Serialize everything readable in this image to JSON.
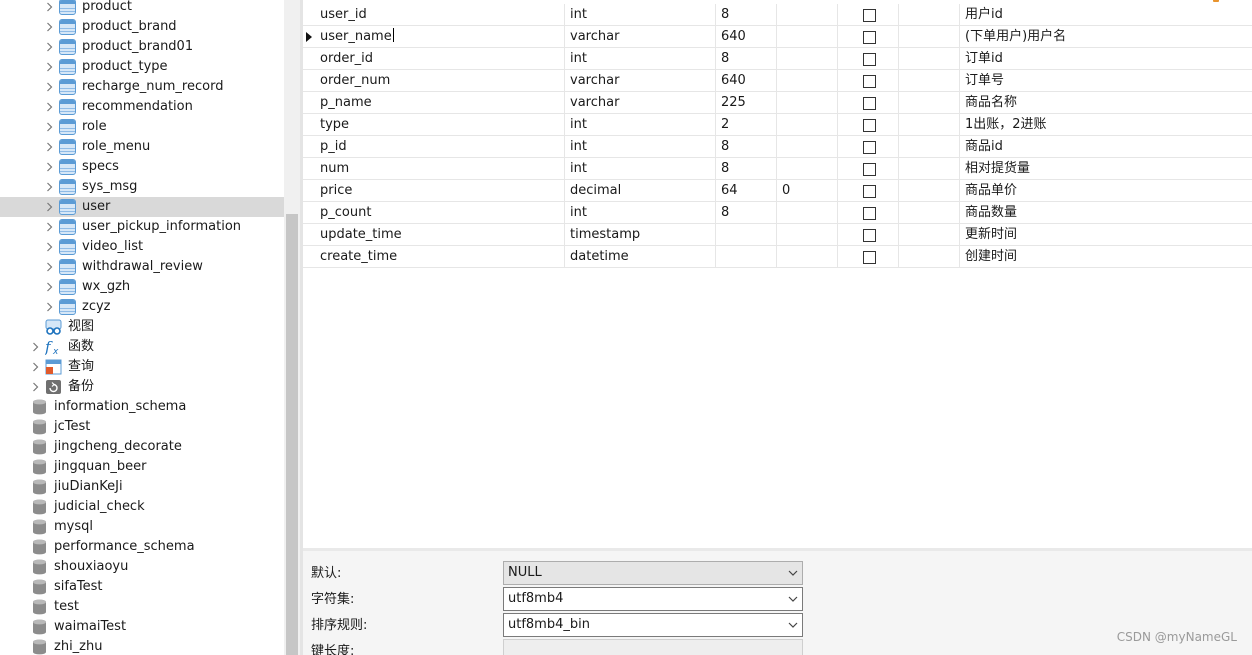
{
  "sidebar": {
    "tables": [
      "product",
      "product_brand",
      "product_brand01",
      "product_type",
      "recharge_num_record",
      "recommendation",
      "role",
      "role_menu",
      "specs",
      "sys_msg",
      "user",
      "user_pickup_information",
      "video_list",
      "withdrawal_review",
      "wx_gzh",
      "zcyz"
    ],
    "selected_table": "user",
    "views_label": "视图",
    "functions_label": "函数",
    "queries_label": "查询",
    "backups_label": "备份",
    "databases": [
      "information_schema",
      "jcTest",
      "jingcheng_decorate",
      "jingquan_beer",
      "jiuDianKeJi",
      "judicial_check",
      "mysql",
      "performance_schema",
      "shouxiaoyu",
      "sifaTest",
      "test",
      "waimaiTest",
      "zhi_zhu"
    ]
  },
  "fields": [
    {
      "name": "user_id",
      "type": "int",
      "length": "8",
      "decimals": "",
      "not_null": false,
      "key": "",
      "comment": "用户id"
    },
    {
      "name": "user_name",
      "type": "varchar",
      "length": "640",
      "decimals": "",
      "not_null": false,
      "key": "",
      "comment": "(下单用户)用户名"
    },
    {
      "name": "order_id",
      "type": "int",
      "length": "8",
      "decimals": "",
      "not_null": false,
      "key": "",
      "comment": "订单id"
    },
    {
      "name": "order_num",
      "type": "varchar",
      "length": "640",
      "decimals": "",
      "not_null": false,
      "key": "",
      "comment": "订单号"
    },
    {
      "name": "p_name",
      "type": "varchar",
      "length": "225",
      "decimals": "",
      "not_null": false,
      "key": "",
      "comment": "商品名称"
    },
    {
      "name": "type",
      "type": "int",
      "length": "2",
      "decimals": "",
      "not_null": false,
      "key": "",
      "comment": "1出账，2进账"
    },
    {
      "name": "p_id",
      "type": "int",
      "length": "8",
      "decimals": "",
      "not_null": false,
      "key": "",
      "comment": "商品id"
    },
    {
      "name": "num",
      "type": "int",
      "length": "8",
      "decimals": "",
      "not_null": false,
      "key": "",
      "comment": "相对提货量"
    },
    {
      "name": "price",
      "type": "decimal",
      "length": "64",
      "decimals": "0",
      "not_null": false,
      "key": "",
      "comment": "商品单价"
    },
    {
      "name": "p_count",
      "type": "int",
      "length": "8",
      "decimals": "",
      "not_null": false,
      "key": "",
      "comment": "商品数量"
    },
    {
      "name": "update_time",
      "type": "timestamp",
      "length": "",
      "decimals": "",
      "not_null": false,
      "key": "",
      "comment": "更新时间"
    },
    {
      "name": "create_time",
      "type": "datetime",
      "length": "",
      "decimals": "",
      "not_null": false,
      "key": "",
      "comment": "创建时间"
    }
  ],
  "current_field": "user_name",
  "properties": {
    "default": {
      "label": "默认:",
      "value": "NULL"
    },
    "charset": {
      "label": "字符集:",
      "value": "utf8mb4"
    },
    "collation": {
      "label": "排序规则:",
      "value": "utf8mb4_bin"
    },
    "key_length": {
      "label": "键长度:",
      "value": ""
    }
  },
  "watermark": "CSDN @myNameGL",
  "colors": {
    "selection": "#d9d9d9",
    "table_icon": "#5b9bd5",
    "database_icon": "#8c8c8c",
    "views_icon": "#1e73be",
    "functions_icon": "#1e73be",
    "queries_icon": "#e05a2b"
  }
}
